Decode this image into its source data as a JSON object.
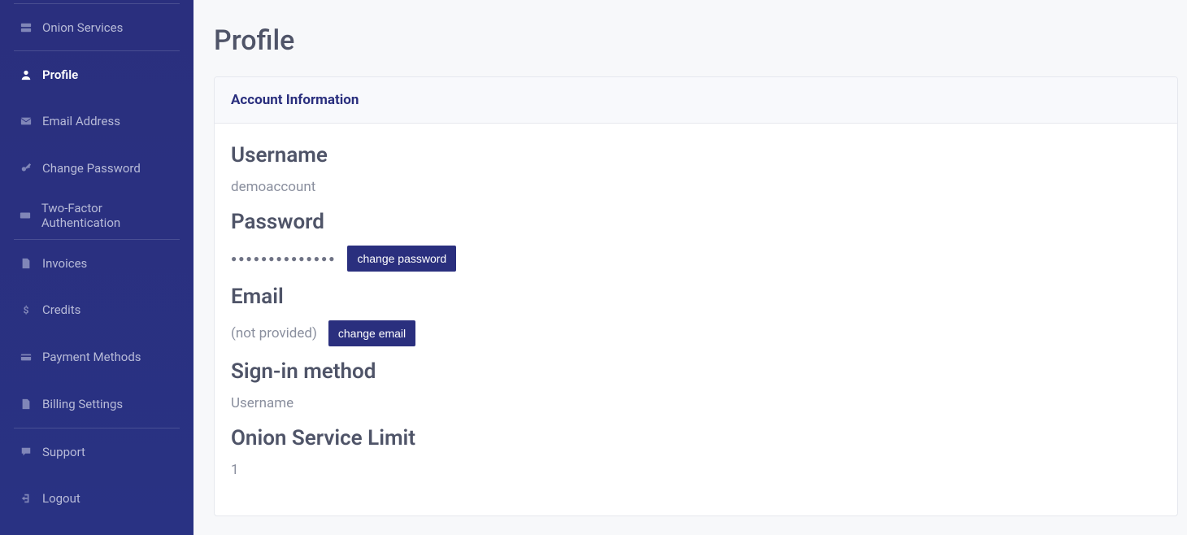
{
  "sidebar": {
    "items": [
      {
        "label": "Onion Services"
      },
      {
        "label": "Profile"
      },
      {
        "label": "Email Address"
      },
      {
        "label": "Change Password"
      },
      {
        "label": "Two-Factor Authentication"
      },
      {
        "label": "Invoices"
      },
      {
        "label": "Credits"
      },
      {
        "label": "Payment Methods"
      },
      {
        "label": "Billing Settings"
      },
      {
        "label": "Support"
      },
      {
        "label": "Logout"
      }
    ]
  },
  "page": {
    "title": "Profile",
    "card_header": "Account Information",
    "username_label": "Username",
    "username_value": "demoaccount",
    "password_label": "Password",
    "password_masked": "●●●●●●●●●●●●●●",
    "change_password_btn": "change password",
    "email_label": "Email",
    "email_value": "(not provided)",
    "change_email_btn": "change email",
    "signin_label": "Sign-in method",
    "signin_value": "Username",
    "limit_label": "Onion Service Limit",
    "limit_value": "1"
  }
}
